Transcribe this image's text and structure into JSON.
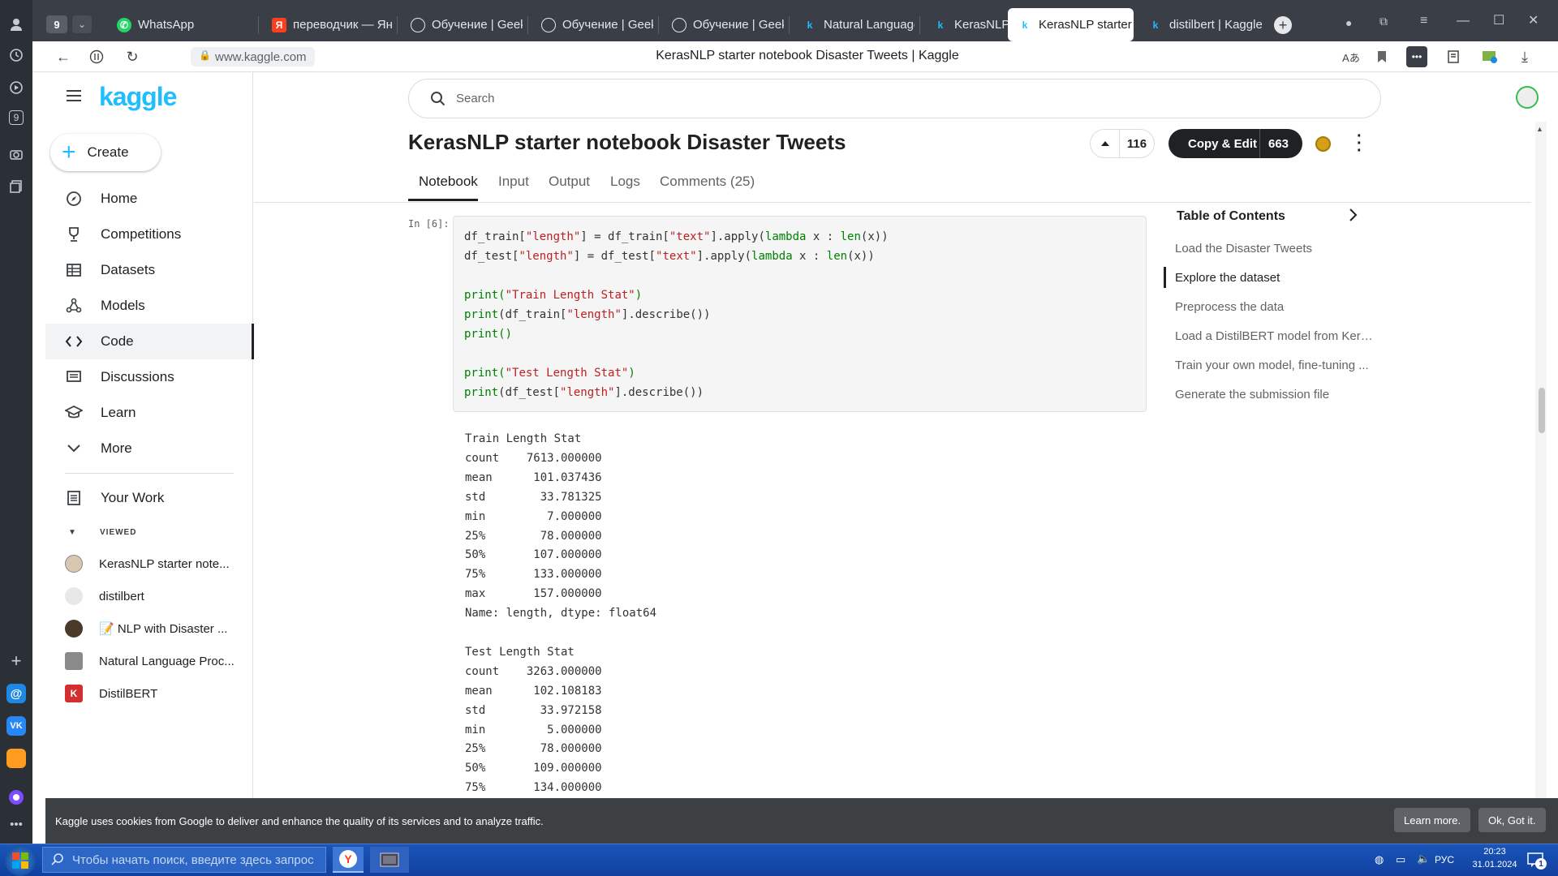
{
  "browser": {
    "tab_count_badge": "9",
    "tabs": [
      {
        "label": "WhatsApp",
        "icon": "whatsapp-icon"
      },
      {
        "label": "переводчик — Янд",
        "icon": "yandex-icon"
      },
      {
        "label": "Обучение | GeekBr",
        "icon": "geekbrains-icon"
      },
      {
        "label": "Обучение | GeekBr",
        "icon": "geekbrains-icon"
      },
      {
        "label": "Обучение | GeekBr",
        "icon": "geekbrains-icon"
      },
      {
        "label": "Natural Language P",
        "icon": "kaggle-icon"
      },
      {
        "label": "KerasNLP starter no",
        "icon": "kaggle-icon"
      },
      {
        "label": "KerasNLP starter",
        "icon": "kaggle-icon"
      },
      {
        "label": "distilbert | Kaggle",
        "icon": "kaggle-icon"
      }
    ],
    "url": "www.kaggle.com",
    "page_title": "KerasNLP starter notebook Disaster Tweets | Kaggle",
    "sidebar_badge": "9"
  },
  "kaggle": {
    "logo": "kaggle",
    "create_label": "Create",
    "nav": [
      {
        "label": "Home",
        "icon": "compass-icon"
      },
      {
        "label": "Competitions",
        "icon": "trophy-icon"
      },
      {
        "label": "Datasets",
        "icon": "table-icon"
      },
      {
        "label": "Models",
        "icon": "models-icon"
      },
      {
        "label": "Code",
        "icon": "code-icon"
      },
      {
        "label": "Discussions",
        "icon": "discussions-icon"
      },
      {
        "label": "Learn",
        "icon": "learn-icon"
      },
      {
        "label": "More",
        "icon": "chevron-down-icon"
      }
    ],
    "your_work": "Your Work",
    "viewed_header": "VIEWED",
    "viewed": [
      {
        "label": "KerasNLP starter note...",
        "icon": "avatar-icon"
      },
      {
        "label": "distilbert",
        "icon": "model-avatar-icon"
      },
      {
        "label": "📝 NLP with Disaster ...",
        "icon": "avatar-icon"
      },
      {
        "label": "Natural Language Proc...",
        "icon": "competition-icon"
      },
      {
        "label": "DistilBERT",
        "icon": "k-icon"
      }
    ]
  },
  "search": {
    "placeholder": "Search"
  },
  "notebook": {
    "title": "KerasNLP starter notebook Disaster Tweets",
    "votes": "116",
    "copy_edit_label": "Copy & Edit",
    "copy_count": "663",
    "tabs": [
      "Notebook",
      "Input",
      "Output",
      "Logs",
      "Comments (25)"
    ],
    "cell_prompt": "In [6]:",
    "code": [
      "df_train[\"length\"] = df_train[\"text\"].apply(lambda x : len(x))",
      "df_test[\"length\"] = df_test[\"text\"].apply(lambda x : len(x))",
      "",
      "print(\"Train Length Stat\")",
      "print(df_train[\"length\"].describe())",
      "print()",
      "",
      "print(\"Test Length Stat\")",
      "print(df_test[\"length\"].describe())"
    ],
    "output": [
      "Train Length Stat",
      "count    7613.000000",
      "mean      101.037436",
      "std        33.781325",
      "min         7.000000",
      "25%        78.000000",
      "50%       107.000000",
      "75%       133.000000",
      "max       157.000000",
      "Name: length, dtype: float64",
      "",
      "Test Length Stat",
      "count    3263.000000",
      "mean      102.108183",
      "std        33.972158",
      "min         5.000000",
      "25%        78.000000",
      "50%       109.000000",
      "75%       134.000000"
    ]
  },
  "toc": {
    "title": "Table of Contents",
    "items": [
      "Load the Disaster Tweets",
      "Explore the dataset",
      "Preprocess the data",
      "Load a DistilBERT model from Kera...",
      "Train your own model, fine-tuning ...",
      "Generate the submission file"
    ]
  },
  "cookie": {
    "text": "Kaggle uses cookies from Google to deliver and enhance the quality of its services and to analyze traffic.",
    "learn_more": "Learn more.",
    "ok": "Ok, Got it."
  },
  "taskbar": {
    "search_placeholder": "Чтобы начать поиск, введите здесь запрос",
    "lang": "РУС",
    "time": "20:23",
    "date": "31.01.2024",
    "notif_count": "1"
  }
}
